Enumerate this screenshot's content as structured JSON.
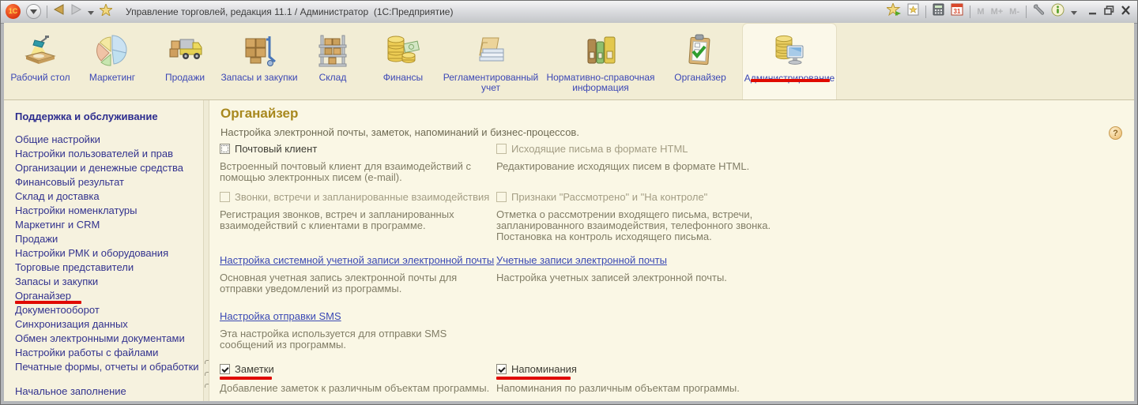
{
  "titlebar": {
    "title": "Управление торговлей, редакция 11.1 / Администратор  (1С:Предприятие)",
    "logo_text": "1С",
    "memory_buttons": [
      "M",
      "M+",
      "M-"
    ]
  },
  "ribbon": {
    "tabs": [
      {
        "label": "Рабочий стол",
        "selected": false
      },
      {
        "label": "Маркетинг",
        "selected": false
      },
      {
        "label": "Продажи",
        "selected": false
      },
      {
        "label": "Запасы и закупки",
        "selected": false
      },
      {
        "label": "Склад",
        "selected": false
      },
      {
        "label": "Финансы",
        "selected": false
      },
      {
        "label": "Регламентированный учет",
        "selected": false
      },
      {
        "label": "Нормативно-справочная информация",
        "selected": false
      },
      {
        "label": "Органайзер",
        "selected": false
      },
      {
        "label": "Администрирование",
        "selected": true,
        "red_underlined": true
      }
    ]
  },
  "sidebar": {
    "header": "Поддержка и обслуживание",
    "items": [
      "Общие настройки",
      "Настройки пользователей и прав",
      "Организации и денежные средства",
      "Финансовый результат",
      "Склад и доставка",
      "Настройки номенклатуры",
      "Маркетинг и CRM",
      "Продажи",
      "Настройки РМК и оборудования",
      "Торговые представители",
      "Запасы и закупки",
      "Органайзер",
      "Документооборот",
      "Синхронизация данных",
      "Обмен электронными документами",
      "Настройки работы с файлами",
      "Печатные формы, отчеты и обработки"
    ],
    "red_underlined_item": "Органайзер",
    "bottom_item": "Начальное заполнение"
  },
  "content": {
    "title": "Органайзер",
    "subtitle": "Настройка электронной почты, заметок, напоминаний и бизнес-процессов.",
    "mail_client": {
      "label": "Почтовый клиент",
      "checked": false,
      "desc": "Встроенный почтовый клиент для взаимодействий с помощью электронных писем (e-mail)."
    },
    "html_mail": {
      "label": "Исходящие письма в формате HTML",
      "checked": false,
      "disabled": true,
      "desc": "Редактирование исходящих писем в формате HTML."
    },
    "calls": {
      "label": "Звонки, встречи и запланированные взаимодействия",
      "checked": false,
      "disabled": true,
      "desc": "Регистрация звонков, встреч и запланированных взаимодействий с клиентами в программе."
    },
    "flags": {
      "label": "Признаки \"Рассмотрено\" и \"На контроле\"",
      "checked": false,
      "disabled": true,
      "desc": "Отметка о рассмотрении входящего письма, встречи, запланированного взаимодействия, телефонного звонка. Постановка на контроль исходящего письма."
    },
    "system_account": {
      "label": "Настройка системной учетной записи электронной почты",
      "desc": "Основная учетная запись электронной почты для отправки уведомлений из программы."
    },
    "accounts": {
      "label": "Учетные записи электронной почты",
      "desc": "Настройка учетных записей электронной почты."
    },
    "sms": {
      "label": "Настройка отправки SMS",
      "desc": "Эта настройка используется для отправки SMS сообщений из программы."
    },
    "notes": {
      "label": "Заметки",
      "checked": true,
      "red_underlined": true,
      "desc": "Добавление заметок к различным объектам программы."
    },
    "reminders": {
      "label": "Напоминания",
      "checked": true,
      "red_underlined": true,
      "desc": "Напоминания по различным объектам программы."
    },
    "help_glyph": "?"
  },
  "colors": {
    "annotation_red": "#e00a00",
    "ribbon_label_blue": "#3b47b5",
    "sidebar_link_blue": "#32328e",
    "heading_gold": "#a8881e",
    "content_link_blue": "#3a49b4",
    "ribbon_bg": "#f2edd5",
    "content_bg": "#faf7e5"
  }
}
